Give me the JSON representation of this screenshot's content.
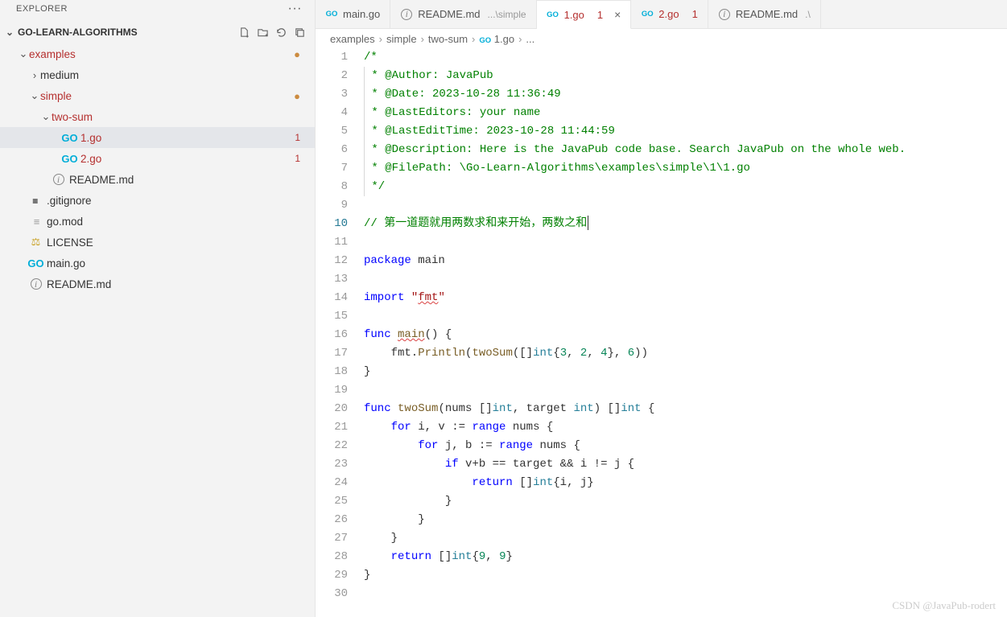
{
  "explorer": {
    "title": "EXPLORER",
    "project": "GO-LEARN-ALGORITHMS",
    "tree": [
      {
        "label": "examples",
        "type": "folder",
        "expanded": true,
        "depth": 0,
        "modified": true,
        "red": true
      },
      {
        "label": "medium",
        "type": "folder",
        "expanded": false,
        "depth": 1
      },
      {
        "label": "simple",
        "type": "folder",
        "expanded": true,
        "depth": 1,
        "modified": true,
        "red": true
      },
      {
        "label": "two-sum",
        "type": "folder",
        "expanded": true,
        "depth": 2,
        "red": true
      },
      {
        "label": "1.go",
        "type": "go",
        "depth": 3,
        "red": true,
        "badge": "1",
        "active": true
      },
      {
        "label": "2.go",
        "type": "go",
        "depth": 3,
        "red": true,
        "badge": "1"
      },
      {
        "label": "README.md",
        "type": "info",
        "depth": 2
      },
      {
        "label": ".gitignore",
        "type": "diamond",
        "depth": 0
      },
      {
        "label": "go.mod",
        "type": "lines",
        "depth": 0
      },
      {
        "label": "LICENSE",
        "type": "lic",
        "depth": 0
      },
      {
        "label": "main.go",
        "type": "go",
        "depth": 0
      },
      {
        "label": "README.md",
        "type": "info",
        "depth": 0
      }
    ]
  },
  "tabs": [
    {
      "icon": "go",
      "label": "main.go"
    },
    {
      "icon": "info",
      "label": "README.md",
      "path": "...\\simple"
    },
    {
      "icon": "go",
      "label": "1.go",
      "red": true,
      "badge": "1",
      "close": true,
      "active": true
    },
    {
      "icon": "go",
      "label": "2.go",
      "red": true,
      "badge": "1"
    },
    {
      "icon": "info",
      "label": "README.md",
      "path": ".\\"
    }
  ],
  "breadcrumb": [
    "examples",
    "simple",
    "two-sum",
    "1.go",
    "..."
  ],
  "code": {
    "lines": [
      {
        "n": 1,
        "tokens": [
          {
            "t": "/*",
            "c": "comment"
          }
        ]
      },
      {
        "n": 2,
        "tokens": [
          {
            "t": " * @Author: JavaPub",
            "c": "comment"
          }
        ]
      },
      {
        "n": 3,
        "tokens": [
          {
            "t": " * @Date: 2023-10-28 11:36:49",
            "c": "comment"
          }
        ]
      },
      {
        "n": 4,
        "tokens": [
          {
            "t": " * @LastEditors: your name",
            "c": "comment"
          }
        ]
      },
      {
        "n": 5,
        "tokens": [
          {
            "t": " * @LastEditTime: 2023-10-28 11:44:59",
            "c": "comment"
          }
        ]
      },
      {
        "n": 6,
        "tokens": [
          {
            "t": " * @Description: Here is the JavaPub code base. Search JavaPub on the whole web.",
            "c": "comment"
          }
        ]
      },
      {
        "n": 7,
        "tokens": [
          {
            "t": " * @FilePath: \\Go-Learn-Algorithms\\examples\\simple\\1\\1.go",
            "c": "comment"
          }
        ]
      },
      {
        "n": 8,
        "tokens": [
          {
            "t": " */",
            "c": "comment"
          }
        ]
      },
      {
        "n": 9,
        "tokens": []
      },
      {
        "n": 10,
        "tokens": [
          {
            "t": "// 第一道题就用两数求和来开始，两数之和",
            "c": "comment"
          }
        ],
        "current": true,
        "cursor": true
      },
      {
        "n": 11,
        "tokens": []
      },
      {
        "n": 12,
        "tokens": [
          {
            "t": "package",
            "c": "keyword"
          },
          {
            "t": " main"
          }
        ]
      },
      {
        "n": 13,
        "tokens": []
      },
      {
        "n": 14,
        "tokens": [
          {
            "t": "import",
            "c": "keyword"
          },
          {
            "t": " "
          },
          {
            "t": "\"",
            "c": "string"
          },
          {
            "t": "fmt",
            "c": "string",
            "err": true
          },
          {
            "t": "\"",
            "c": "string"
          }
        ]
      },
      {
        "n": 15,
        "tokens": []
      },
      {
        "n": 16,
        "tokens": [
          {
            "t": "func",
            "c": "keyword"
          },
          {
            "t": " "
          },
          {
            "t": "main",
            "c": "func",
            "err": true
          },
          {
            "t": "() {"
          }
        ]
      },
      {
        "n": 17,
        "tokens": [
          {
            "t": "    fmt."
          },
          {
            "t": "Println",
            "c": "func"
          },
          {
            "t": "("
          },
          {
            "t": "twoSum",
            "c": "func"
          },
          {
            "t": "([]"
          },
          {
            "t": "int",
            "c": "type"
          },
          {
            "t": "{"
          },
          {
            "t": "3",
            "c": "num"
          },
          {
            "t": ", "
          },
          {
            "t": "2",
            "c": "num"
          },
          {
            "t": ", "
          },
          {
            "t": "4",
            "c": "num"
          },
          {
            "t": "}, "
          },
          {
            "t": "6",
            "c": "num"
          },
          {
            "t": "))"
          }
        ]
      },
      {
        "n": 18,
        "tokens": [
          {
            "t": "}"
          }
        ]
      },
      {
        "n": 19,
        "tokens": []
      },
      {
        "n": 20,
        "tokens": [
          {
            "t": "func",
            "c": "keyword"
          },
          {
            "t": " "
          },
          {
            "t": "twoSum",
            "c": "func"
          },
          {
            "t": "(nums []"
          },
          {
            "t": "int",
            "c": "type"
          },
          {
            "t": ", target "
          },
          {
            "t": "int",
            "c": "type"
          },
          {
            "t": ") []"
          },
          {
            "t": "int",
            "c": "type"
          },
          {
            "t": " {"
          }
        ]
      },
      {
        "n": 21,
        "tokens": [
          {
            "t": "    "
          },
          {
            "t": "for",
            "c": "keyword"
          },
          {
            "t": " i, v := "
          },
          {
            "t": "range",
            "c": "keyword"
          },
          {
            "t": " nums {"
          }
        ]
      },
      {
        "n": 22,
        "tokens": [
          {
            "t": "        "
          },
          {
            "t": "for",
            "c": "keyword"
          },
          {
            "t": " j, b := "
          },
          {
            "t": "range",
            "c": "keyword"
          },
          {
            "t": " nums {"
          }
        ]
      },
      {
        "n": 23,
        "tokens": [
          {
            "t": "            "
          },
          {
            "t": "if",
            "c": "keyword"
          },
          {
            "t": " v+b == target && i != j {"
          }
        ]
      },
      {
        "n": 24,
        "tokens": [
          {
            "t": "                "
          },
          {
            "t": "return",
            "c": "keyword"
          },
          {
            "t": " []"
          },
          {
            "t": "int",
            "c": "type"
          },
          {
            "t": "{i, j}"
          }
        ]
      },
      {
        "n": 25,
        "tokens": [
          {
            "t": "            }"
          }
        ]
      },
      {
        "n": 26,
        "tokens": [
          {
            "t": "        }"
          }
        ]
      },
      {
        "n": 27,
        "tokens": [
          {
            "t": "    }"
          }
        ]
      },
      {
        "n": 28,
        "tokens": [
          {
            "t": "    "
          },
          {
            "t": "return",
            "c": "keyword"
          },
          {
            "t": " []"
          },
          {
            "t": "int",
            "c": "type"
          },
          {
            "t": "{"
          },
          {
            "t": "9",
            "c": "num"
          },
          {
            "t": ", "
          },
          {
            "t": "9",
            "c": "num"
          },
          {
            "t": "}"
          }
        ]
      },
      {
        "n": 29,
        "tokens": [
          {
            "t": "}"
          }
        ]
      },
      {
        "n": 30,
        "tokens": []
      }
    ]
  },
  "watermark": "CSDN @JavaPub-rodert"
}
